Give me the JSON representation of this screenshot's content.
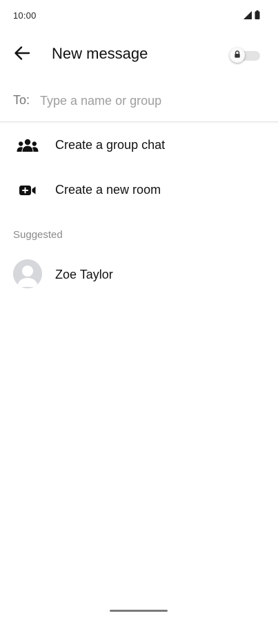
{
  "status_bar": {
    "time": "10:00",
    "icons": [
      "signal-icon",
      "battery-icon"
    ]
  },
  "header": {
    "title": "New message",
    "back_icon": "back-arrow-icon",
    "toggle": {
      "icon": "lock-icon",
      "state": "off"
    }
  },
  "recipient": {
    "label": "To:",
    "value": "",
    "placeholder": "Type a name or group"
  },
  "actions": [
    {
      "label": "Create a group chat",
      "icon": "group-icon"
    },
    {
      "label": "Create a new room",
      "icon": "video-add-icon"
    }
  ],
  "suggested": {
    "header": "Suggested",
    "contacts": [
      {
        "name": "Zoe Taylor",
        "icon": "avatar"
      }
    ]
  },
  "colors": {
    "text": "#111111",
    "secondary": "#8a8a8a",
    "placeholder": "#9e9e9e",
    "toggle_track": "#e3e3e3",
    "avatar_bg": "#d5d7db"
  }
}
